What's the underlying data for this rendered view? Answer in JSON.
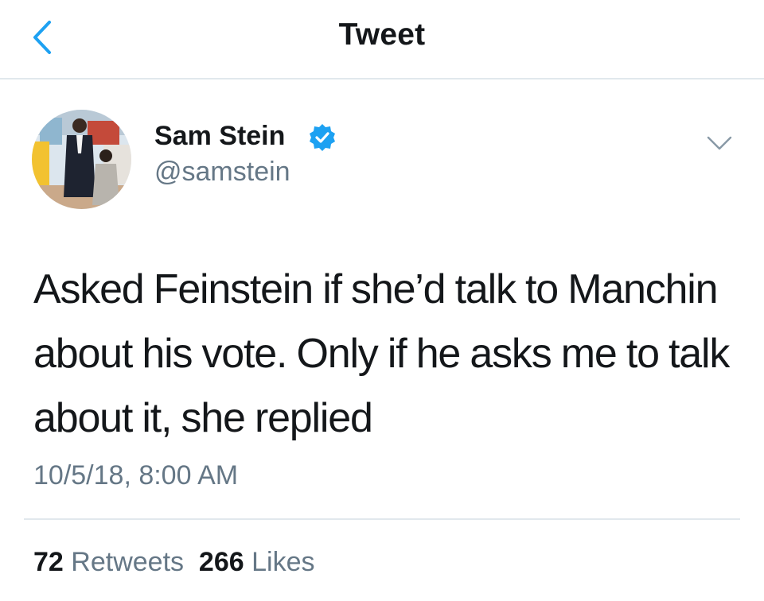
{
  "nav": {
    "title": "Tweet"
  },
  "tweet": {
    "author_name": "Sam Stein",
    "author_handle": "@samstein",
    "text": "Asked Feinstein if she’d talk to Manchin about his vote. Only if he asks me to talk about it, she replied",
    "timestamp": "10/5/18, 8:00 AM"
  },
  "stats": {
    "retweets_count": "72",
    "retweets_label": "Retweets",
    "likes_count": "266",
    "likes_label": "Likes"
  },
  "icons": {
    "back": "chevron-left-icon",
    "verified": "verified-badge-icon",
    "more": "chevron-down-icon"
  },
  "colors": {
    "accent": "#1da1f2",
    "text": "#14171a",
    "secondary_text": "#657786",
    "divider": "#e1e8ed"
  }
}
